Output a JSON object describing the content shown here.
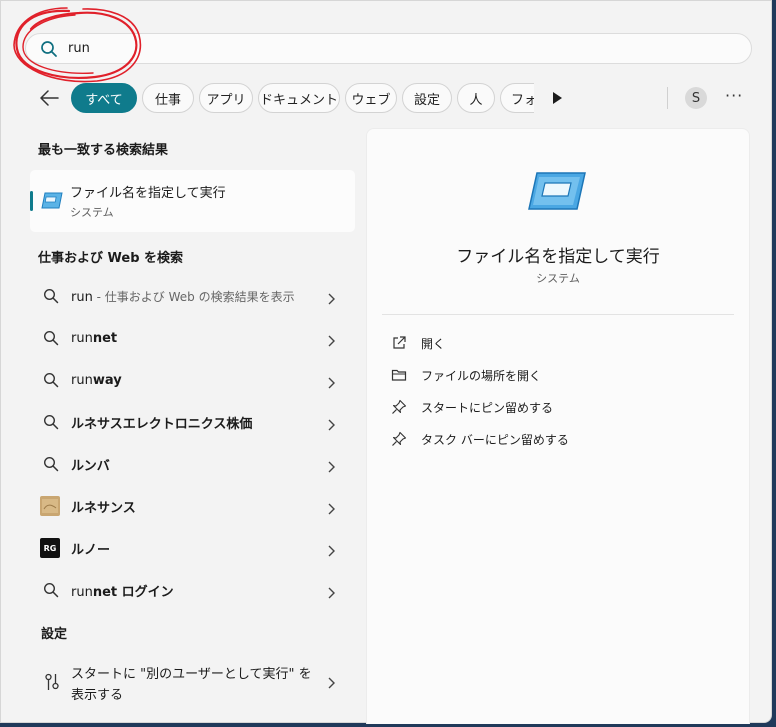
{
  "search": {
    "value": "run"
  },
  "filters": {
    "tabs": [
      "すべて",
      "仕事",
      "アプリ",
      "ドキュメント",
      "ウェブ",
      "設定",
      "人",
      "フォ"
    ],
    "avatar_initial": "S",
    "more": "···"
  },
  "best_match": {
    "heading": "最も一致する検索結果",
    "title": "ファイル名を指定して実行",
    "subtitle": "システム",
    "icon": "run-dialog-icon"
  },
  "web_search": {
    "heading": "仕事および Web を検索",
    "first": {
      "query": "run",
      "hint": " - 仕事および Web の検索結果を表示"
    },
    "items": [
      {
        "prefix": "run",
        "bold": "net",
        "icon": "search-icon"
      },
      {
        "prefix": "run",
        "bold": "way",
        "icon": "search-icon"
      },
      {
        "prefix": "",
        "bold": "ルネサスエレクトロニクス株価",
        "icon": "search-icon"
      },
      {
        "prefix": "",
        "bold": "ルンバ",
        "icon": "search-icon"
      },
      {
        "prefix": "",
        "bold": "ルネサンス",
        "icon": "renaissance-thumbnail"
      },
      {
        "prefix": "",
        "bold": "ルノー",
        "icon": "rg-logo",
        "logo_text": "RG"
      },
      {
        "prefix": "run",
        "bold": "net ログイン",
        "icon": "search-icon"
      }
    ]
  },
  "settings": {
    "heading": "設定",
    "line1": "スタートに \"別のユーザーとして実行\" を",
    "line2": "表示する"
  },
  "detail": {
    "title": "ファイル名を指定して実行",
    "subtitle": "システム",
    "actions": [
      {
        "label": "開く",
        "icon": "open-external-icon"
      },
      {
        "label": "ファイルの場所を開く",
        "icon": "folder-icon"
      },
      {
        "label": "スタートにピン留めする",
        "icon": "pin-icon"
      },
      {
        "label": "タスク バーにピン留めする",
        "icon": "pin-icon"
      }
    ]
  },
  "colors": {
    "accent": "#0f7b8c",
    "annotation": "#e0202a"
  }
}
